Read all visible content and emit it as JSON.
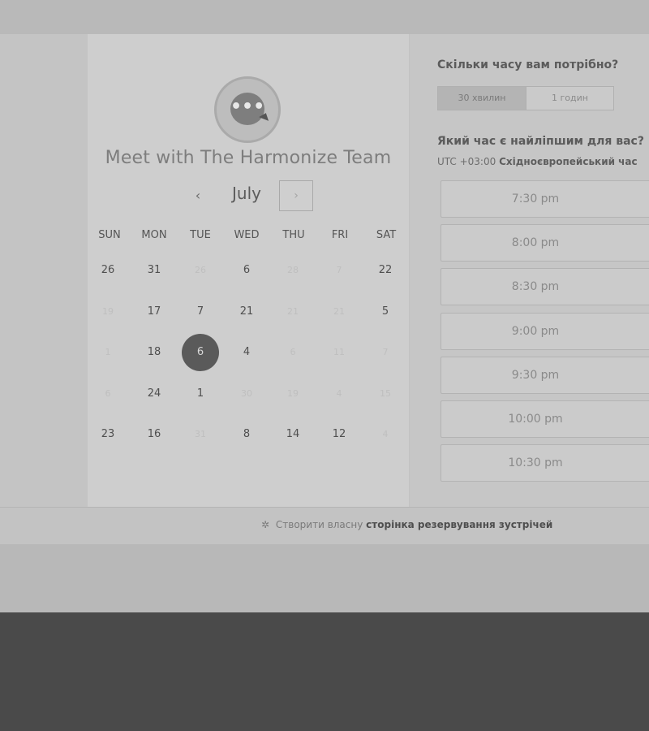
{
  "calendar": {
    "team_title": "Meet with The Harmonize Team",
    "logo_glyph": "•••",
    "month": "July",
    "prev_glyph": "‹",
    "next_glyph": "›",
    "weekdays": [
      "SUN",
      "MON",
      "TUE",
      "WED",
      "THU",
      "FRI",
      "SAT"
    ],
    "weeks": [
      [
        {
          "d": "26",
          "muted": false
        },
        {
          "d": "31",
          "muted": false
        },
        {
          "d": "26",
          "muted": true
        },
        {
          "d": "6",
          "muted": false
        },
        {
          "d": "28",
          "muted": true
        },
        {
          "d": "7",
          "muted": true
        },
        {
          "d": "22",
          "muted": false
        }
      ],
      [
        {
          "d": "19",
          "muted": true
        },
        {
          "d": "17",
          "muted": false
        },
        {
          "d": "7",
          "muted": false
        },
        {
          "d": "21",
          "muted": false
        },
        {
          "d": "21",
          "muted": true
        },
        {
          "d": "21",
          "muted": true
        },
        {
          "d": "5",
          "muted": false
        }
      ],
      [
        {
          "d": "1",
          "muted": true
        },
        {
          "d": "18",
          "muted": false
        },
        {
          "d": "6",
          "muted": false,
          "selected": true
        },
        {
          "d": "4",
          "muted": false
        },
        {
          "d": "6",
          "muted": true
        },
        {
          "d": "11",
          "muted": true
        },
        {
          "d": "7",
          "muted": true
        }
      ],
      [
        {
          "d": "6",
          "muted": true
        },
        {
          "d": "24",
          "muted": false
        },
        {
          "d": "1",
          "muted": false
        },
        {
          "d": "30",
          "muted": true
        },
        {
          "d": "19",
          "muted": true
        },
        {
          "d": "4",
          "muted": true
        },
        {
          "d": "15",
          "muted": true
        }
      ],
      [
        {
          "d": "23",
          "muted": false
        },
        {
          "d": "16",
          "muted": false
        },
        {
          "d": "31",
          "muted": true
        },
        {
          "d": "8",
          "muted": false
        },
        {
          "d": "14",
          "muted": false
        },
        {
          "d": "12",
          "muted": false
        },
        {
          "d": "4",
          "muted": true
        }
      ]
    ]
  },
  "booking": {
    "duration_question": "Скільки часу вам потрібно?",
    "duration_options": [
      {
        "label": "30 хвилин",
        "active": true
      },
      {
        "label": "1 годин",
        "active": false
      }
    ],
    "time_question": "Який час є найліпшим для вас?",
    "timezone_offset": "UTC +03:00",
    "timezone_name": "Східноєвропейський час",
    "slots": [
      "7:30 pm",
      "8:00 pm",
      "8:30 pm",
      "9:00 pm",
      "9:30 pm",
      "10:00 pm",
      "10:30 pm"
    ]
  },
  "footer": {
    "icon": "spark-icon",
    "glyph": "✲",
    "text_prefix": "Створити власну",
    "text_bold": "сторінка резервування зустрічей"
  }
}
